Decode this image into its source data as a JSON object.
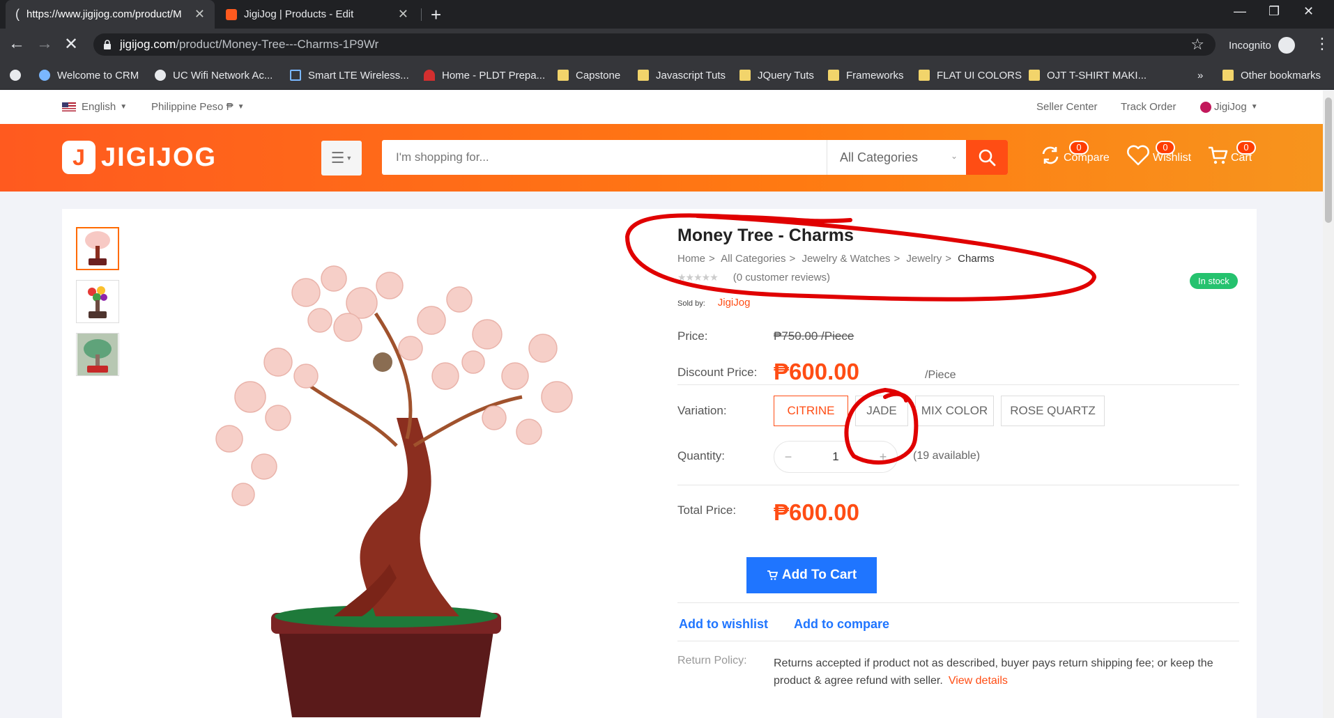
{
  "browser": {
    "tabs": [
      {
        "title": "https://www.jigijog.com/product/M",
        "close": "✕"
      },
      {
        "title": "JigiJog | Products - Edit",
        "close": "✕"
      }
    ],
    "new_tab": "+",
    "window_controls": [
      "—",
      "❐",
      "✕"
    ],
    "address": {
      "domain": "jigijog.com",
      "path": "/product/Money-Tree---Charms-1P9Wr"
    },
    "star": "☆",
    "incognito_label": "Incognito",
    "menu": "⋮",
    "bookmarks": [
      {
        "label": "Welcome to CRM",
        "icon": "crm-icon"
      },
      {
        "label": "UC Wifi Network Ac...",
        "icon": "globe-icon"
      },
      {
        "label": "Smart LTE Wireless...",
        "icon": "router-icon"
      },
      {
        "label": "Home - PLDT Prepa...",
        "icon": "pldt-icon"
      },
      {
        "label": "Capstone",
        "icon": "folder-icon"
      },
      {
        "label": "Javascript Tuts",
        "icon": "folder-icon"
      },
      {
        "label": "JQuery Tuts",
        "icon": "folder-icon"
      },
      {
        "label": "Frameworks",
        "icon": "folder-icon"
      },
      {
        "label": "FLAT UI COLORS",
        "icon": "folder-icon"
      },
      {
        "label": "OJT T-SHIRT MAKI...",
        "icon": "folder-icon"
      }
    ],
    "bookmarks_overflow": "»",
    "other_bookmarks": "Other bookmarks"
  },
  "topbar": {
    "language": "English",
    "currency": "Philippine Peso ₱",
    "seller_center": "Seller Center",
    "track_order": "Track Order",
    "account": "JigiJog"
  },
  "header": {
    "logo_mark": "J",
    "logo_text": "JIGIJOG",
    "search_placeholder": "I'm shopping for...",
    "category": "All Categories",
    "compare": {
      "label": "Compare",
      "count": "0"
    },
    "wishlist": {
      "label": "Wishlist",
      "count": "0"
    },
    "cart": {
      "label": "Cart",
      "count": "0"
    }
  },
  "product": {
    "title": "Money Tree - Charms",
    "breadcrumb": [
      "Home",
      "All Categories",
      "Jewelry & Watches",
      "Jewelry",
      "Charms"
    ],
    "breadcrumb_sep": ">",
    "stars": "★★★★★",
    "reviews": "(0 customer reviews)",
    "stock": "In stock",
    "sold_by_label": "Sold by:",
    "seller": "JigiJog",
    "price_label": "Price:",
    "old_price": "₱750.00 /Piece",
    "discount_label": "Discount Price:",
    "discount_price": "₱600.00",
    "unit": "/Piece",
    "variation_label": "Variation:",
    "variations": [
      "CITRINE",
      "JADE",
      "MIX COLOR",
      "ROSE QUARTZ"
    ],
    "selected_variation": "CITRINE",
    "quantity_label": "Quantity:",
    "qty_minus": "−",
    "qty_value": "1",
    "qty_plus": "+",
    "available": "(19 available)",
    "total_label": "Total Price:",
    "total_price": "₱600.00",
    "add_to_cart": "Add To Cart",
    "add_to_wishlist": "Add to wishlist",
    "add_to_compare": "Add to compare",
    "return_policy_label": "Return Policy:",
    "return_policy_text": "Returns accepted if product not as described, buyer pays return shipping fee; or keep the product & agree refund with seller.",
    "view_details": "View details"
  },
  "colors": {
    "brand_orange": "#ff5a1f",
    "price_orange": "#ff4d14",
    "button_blue": "#1f75ff",
    "stock_green": "#25c26e",
    "annotation_red": "#e00000"
  }
}
